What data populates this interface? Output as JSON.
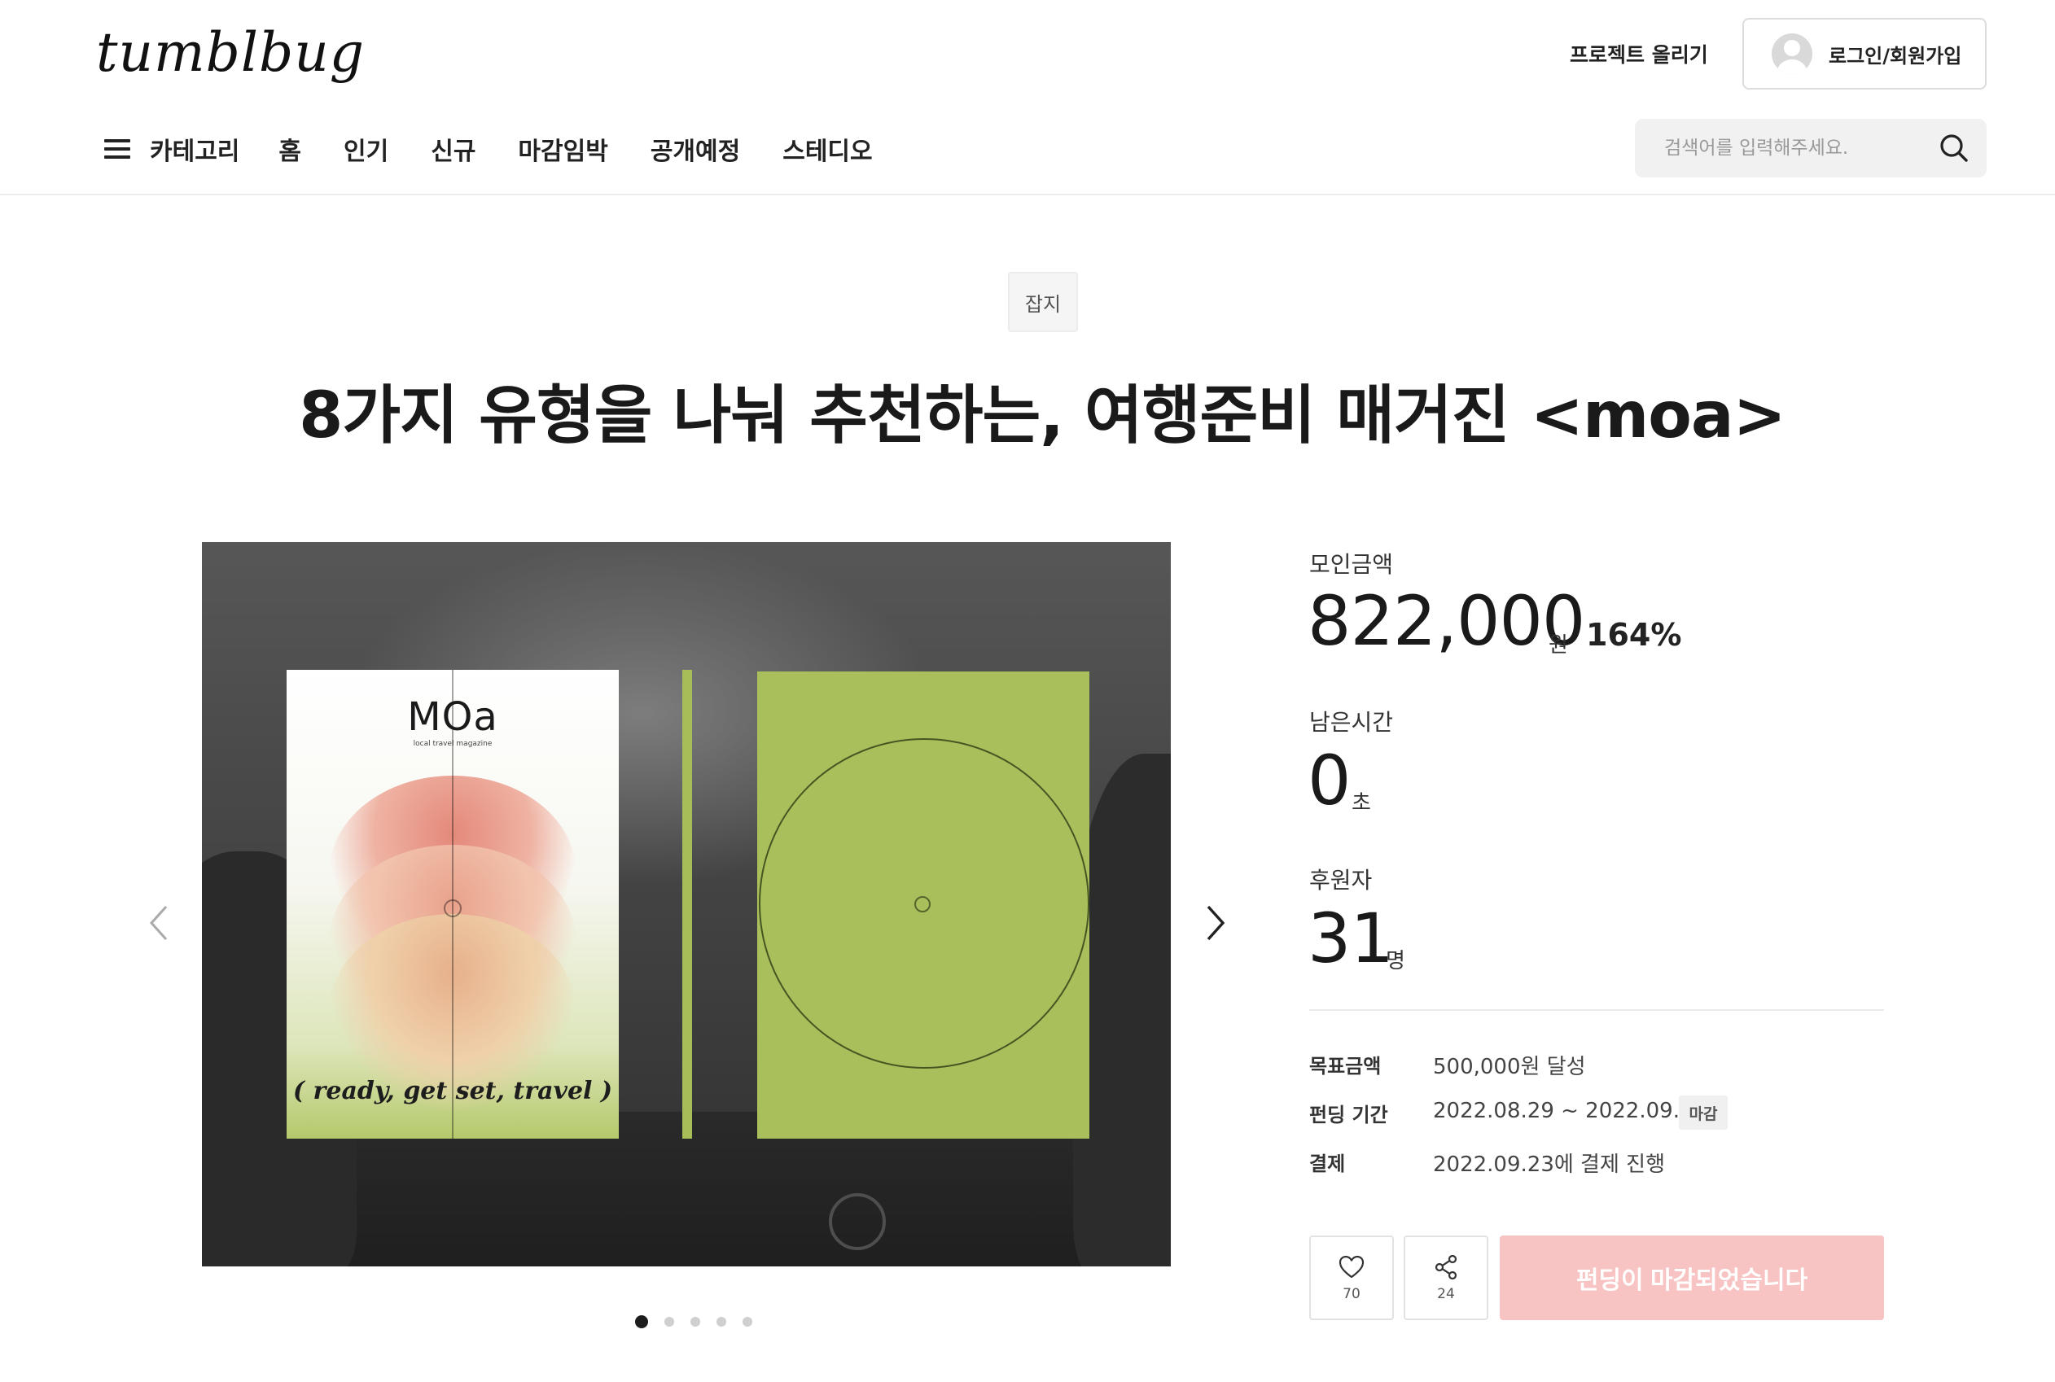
{
  "header": {
    "logo": "tumblbug",
    "upload_label": "프로젝트 올리기",
    "login_label": "로그인/회원가입",
    "nav": {
      "category": "카테고리",
      "items": [
        "홈",
        "인기",
        "신규",
        "마감임박",
        "공개예정",
        "스테디오"
      ]
    },
    "search": {
      "placeholder": "검색어를 입력해주세요."
    }
  },
  "project": {
    "category_tag": "잡지",
    "title": "8가지 유형을 나눠 추천하는, 여행준비 매거진 <moa>",
    "image": {
      "cover_logo": "MOa",
      "cover_subtitle": "local travel magazine",
      "cover_tagline": "(  ready, get set, travel  )",
      "slide_count": 5,
      "active_slide": 1
    }
  },
  "stats": {
    "raised_label": "모인금액",
    "raised_value": "822,000",
    "raised_unit": "원",
    "raised_percent": "164%",
    "time_label": "남은시간",
    "time_value": "0",
    "time_unit": "초",
    "backers_label": "후원자",
    "backers_value": "31",
    "backers_unit": "명"
  },
  "info": {
    "goal_label": "목표금액",
    "goal_value": "500,000원 달성",
    "period_label": "펀딩 기간",
    "period_value": "2022.08.29 ~ 2022.09.22",
    "period_badge": "마감",
    "payment_label": "결제",
    "payment_value": "2022.09.23에 결제 진행"
  },
  "actions": {
    "like_count": "70",
    "share_count": "24",
    "fund_label": "펀딩이 마감되었습니다"
  },
  "colors": {
    "fund_button_disabled": "#f8c3c3",
    "cover_green": "#a9bf5c"
  }
}
